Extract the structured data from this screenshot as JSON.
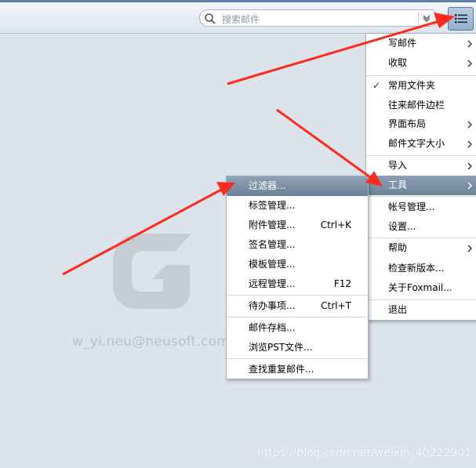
{
  "toolbar": {
    "search_placeholder": "搜索邮件",
    "menu_button_icon": "list-menu-icon"
  },
  "watermark": {
    "email": "w_yi.neu@neusoft.com"
  },
  "footer": {
    "csdn_url": "https://blog.csdn.net/weixin_40222901"
  },
  "main_menu": {
    "write": "写邮件",
    "receive": "收取",
    "common_folders": "常用文件夹",
    "contacts_sidebar": "往来邮件边栏",
    "layout": "界面布局",
    "font_size": "邮件文字大小",
    "import": "导入",
    "tools": "工具",
    "accounts": "帐号管理...",
    "settings": "设置...",
    "help": "帮助",
    "check_update": "检查新版本...",
    "about": "关于Foxmail...",
    "exit": "退出"
  },
  "tools_menu": {
    "filter": "过滤器...",
    "tags": "标签管理...",
    "attachments": "附件管理...",
    "attachments_shortcut": "Ctrl+K",
    "signature": "签名管理...",
    "templates": "模板管理...",
    "remote": "远程管理...",
    "remote_shortcut": "F12",
    "todo": "待办事项...",
    "todo_shortcut": "Ctrl+T",
    "archive": "邮件存档...",
    "browse_pst": "浏览PST文件...",
    "find_duplicates": "查找重复邮件..."
  },
  "colors": {
    "highlight": "#7a8fa6",
    "arrow": "#ff2a1f",
    "titlebar": "#5d7fa9"
  }
}
